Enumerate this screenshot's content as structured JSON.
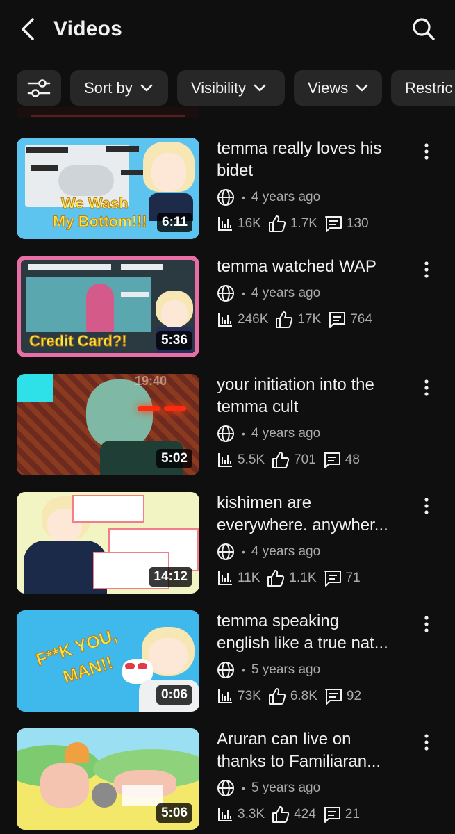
{
  "header": {
    "title": "Videos",
    "back_icon": "chevron-left-icon",
    "search_icon": "search-icon"
  },
  "filters": {
    "settings_icon": "sliders-icon",
    "chips": [
      {
        "label": "Sort by"
      },
      {
        "label": "Visibility"
      },
      {
        "label": "Views"
      },
      {
        "label": "Restric"
      }
    ]
  },
  "videos": [
    {
      "title_lines": [
        "temma really loves his",
        "bidet"
      ],
      "duration": "6:11",
      "visibility_icon": "globe-icon",
      "age": "4 years ago",
      "views": "16K",
      "likes": "1.7K",
      "comments": "130",
      "thumb_text": [
        "We Wash",
        "My Bottom!!!"
      ],
      "thumb_colors": {
        "bg": "#5cc4ee",
        "accent": "#f5e84a"
      }
    },
    {
      "title_lines": [
        "temma watched WAP"
      ],
      "duration": "5:36",
      "visibility_icon": "globe-icon",
      "age": "4 years ago",
      "views": "246K",
      "likes": "17K",
      "comments": "764",
      "thumb_text": [
        "Credit Card?!"
      ],
      "thumb_colors": {
        "bg": "#e86ea5",
        "accent": "#f5e84a"
      }
    },
    {
      "title_lines": [
        "your initiation into the",
        "temma cult"
      ],
      "duration": "5:02",
      "visibility_icon": "globe-icon",
      "age": "4 years ago",
      "views": "5.5K",
      "likes": "701",
      "comments": "48",
      "thumb_text": [
        "19:40"
      ],
      "thumb_colors": {
        "bg": "#8a2a22",
        "accent": "#2ee0e8"
      }
    },
    {
      "title_lines": [
        "kishimen are",
        "everywhere. anywher..."
      ],
      "duration": "14:12",
      "visibility_icon": "globe-icon",
      "age": "4 years ago",
      "views": "11K",
      "likes": "1.1K",
      "comments": "71",
      "thumb_text": [],
      "thumb_colors": {
        "bg": "#f2f4c4",
        "accent": "#f27e8a"
      }
    },
    {
      "title_lines": [
        "temma speaking",
        "english like a true nat..."
      ],
      "duration": "0:06",
      "visibility_icon": "globe-icon",
      "age": "5 years ago",
      "views": "73K",
      "likes": "6.8K",
      "comments": "92",
      "thumb_text": [
        "F**K YOU,",
        "MAN!!"
      ],
      "thumb_colors": {
        "bg": "#3fb8ec",
        "accent": "#f5e84a"
      }
    },
    {
      "title_lines": [
        "Aruran can live on",
        "thanks to Familiaran..."
      ],
      "duration": "5:06",
      "visibility_icon": "globe-icon",
      "age": "5 years ago",
      "views": "3.3K",
      "likes": "424",
      "comments": "21",
      "thumb_text": [],
      "thumb_colors": {
        "bg": "#9be0f2",
        "accent": "#f3e86a"
      }
    }
  ]
}
